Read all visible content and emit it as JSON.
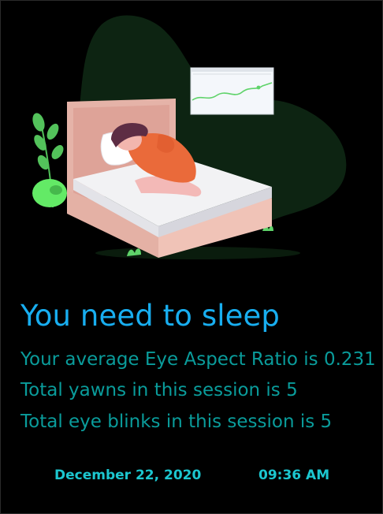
{
  "headline": "You need to sleep",
  "stats": {
    "ear": "Your average Eye Aspect Ratio is 0.231",
    "yawns": "Total yawns in this session is 5",
    "blinks": "Total eye blinks in this session is 5"
  },
  "footer": {
    "date": "December 22, 2020",
    "time": "09:36 AM"
  },
  "colors": {
    "background": "#000000",
    "headline": "#18aef0",
    "stats": "#0a9c9b",
    "footer": "#1cc6cf"
  },
  "icons": [
    "sleeping-person-illustration",
    "monitor-chart-icon",
    "plant-icon"
  ]
}
